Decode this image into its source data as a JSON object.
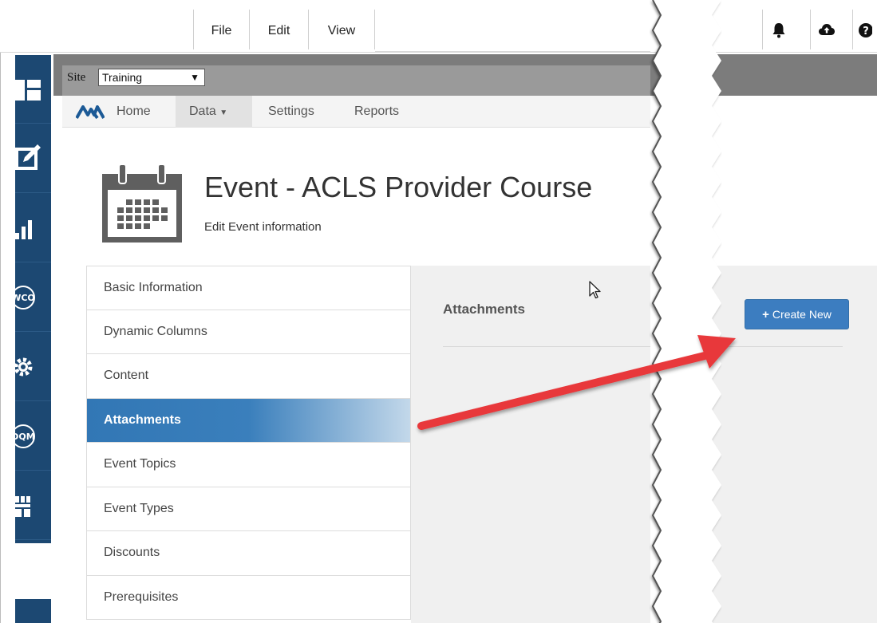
{
  "menubar": {
    "items": [
      "File",
      "Edit",
      "View"
    ]
  },
  "top_icons": [
    "bell-icon",
    "cloud-upload-icon",
    "help-icon"
  ],
  "sidebar": {
    "icons": [
      "layout-icon",
      "edit-icon",
      "bar-chart-icon",
      "wco-icon",
      "gear-icon",
      "dqm-icon",
      "org-chart-icon"
    ],
    "wco_label": "WCO",
    "dqm_label": "DQM",
    "color": "#1c4872"
  },
  "sitebar": {
    "label": "Site",
    "selected": "Training"
  },
  "nav": {
    "home": "Home",
    "data": "Data",
    "settings": "Settings",
    "reports": "Reports"
  },
  "header": {
    "title": "Event - ACLS Provider Course",
    "subtitle": "Edit Event information"
  },
  "tabs": [
    {
      "label": "Basic Information",
      "active": false
    },
    {
      "label": "Dynamic Columns",
      "active": false
    },
    {
      "label": "Content",
      "active": false
    },
    {
      "label": "Attachments",
      "active": true
    },
    {
      "label": "Event Topics",
      "active": false
    },
    {
      "label": "Event Types",
      "active": false
    },
    {
      "label": "Discounts",
      "active": false
    },
    {
      "label": "Prerequisites",
      "active": false
    }
  ],
  "pane": {
    "title": "Attachments"
  },
  "actions": {
    "create_new": "Create New"
  },
  "colors": {
    "accent": "#3c7dc0",
    "arrow": "#e8373a"
  }
}
